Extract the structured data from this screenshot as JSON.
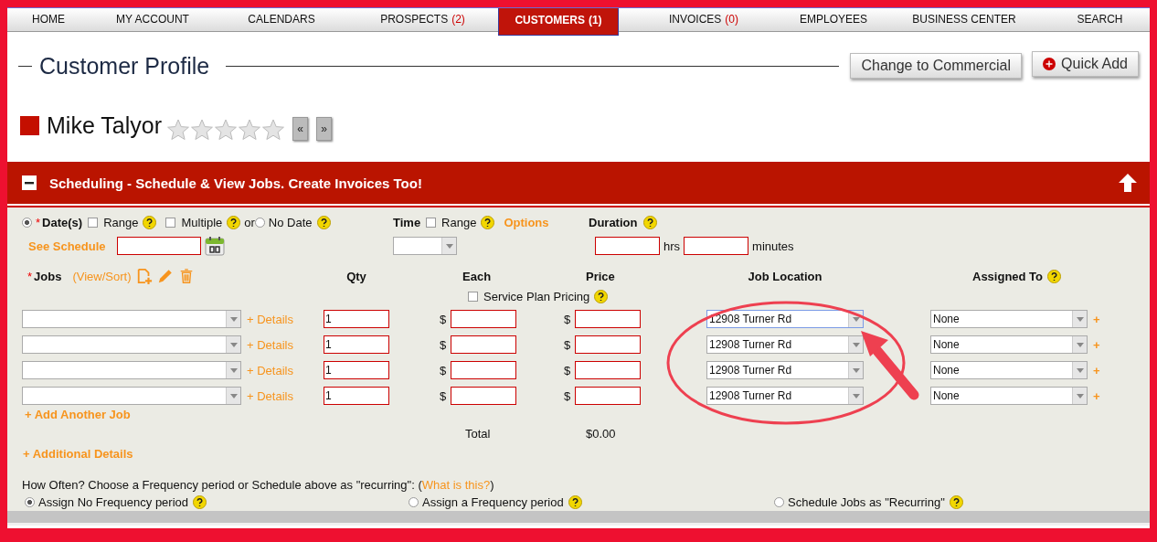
{
  "nav": [
    {
      "label": "HOME",
      "selected": false
    },
    {
      "label": "MY ACCOUNT",
      "selected": false
    },
    {
      "label": "CALENDARS",
      "selected": false
    },
    {
      "label": "PROSPECTS",
      "count": "(2)",
      "selected": false
    },
    {
      "label": "CUSTOMERS",
      "count": "(1)",
      "selected": true
    },
    {
      "label": "INVOICES",
      "count": "(0)",
      "selected": false
    },
    {
      "label": "EMPLOYEES",
      "selected": false
    },
    {
      "label": "BUSINESS CENTER",
      "selected": false
    },
    {
      "label": "SEARCH",
      "selected": false
    }
  ],
  "page_title": "Customer Profile",
  "header_buttons": [
    {
      "label": "Change to Commercial",
      "kind": "plain"
    },
    {
      "label": "Quick Add",
      "kind": "add"
    }
  ],
  "customer": {
    "name": "Mike Talyor",
    "stars": 0,
    "prev": "«",
    "next": "»"
  },
  "section": {
    "title": "Scheduling - Schedule & View Jobs. Create Invoices Too!"
  },
  "date_choices": [
    {
      "kind": "radio",
      "label": "Date(s)",
      "selected": true,
      "required_mark": "*"
    },
    {
      "kind": "checkbox",
      "label": "Range",
      "checked": false,
      "help": true
    },
    {
      "kind": "checkbox",
      "label": "Multiple",
      "checked": false,
      "help": true
    },
    {
      "kind": "text",
      "label": "or",
      "help": false
    },
    {
      "kind": "radio",
      "label": "No Date",
      "selected": false,
      "help": true
    }
  ],
  "see_schedule": "See Schedule",
  "time": {
    "label": "Time",
    "range": {
      "label": "Range",
      "checked": false
    },
    "options_link": "Options"
  },
  "duration": {
    "label": "Duration",
    "hours_unit": "hrs",
    "minutes_unit": "minutes"
  },
  "jobs": {
    "required_mark": "*",
    "label": "Jobs",
    "view_sort": "(View/Sort)",
    "columns": {
      "qty": "Qty",
      "each": "Each",
      "price": "Price",
      "location": "Job Location",
      "assigned": "Assigned To"
    },
    "service_plan": {
      "label": "Service Plan Pricing",
      "checked": false
    },
    "rows": [
      {
        "details_link": "+ Details",
        "qty": "1",
        "each_currency": "$",
        "price_currency": "$",
        "location": "12908 Turner Rd",
        "focused": true,
        "assigned": "None",
        "add_mark": "+"
      },
      {
        "details_link": "+ Details",
        "qty": "1",
        "each_currency": "$",
        "price_currency": "$",
        "location": "12908 Turner Rd",
        "focused": false,
        "assigned": "None",
        "add_mark": "+"
      },
      {
        "details_link": "+ Details",
        "qty": "1",
        "each_currency": "$",
        "price_currency": "$",
        "location": "12908 Turner Rd",
        "focused": false,
        "assigned": "None",
        "add_mark": "+"
      },
      {
        "details_link": "+ Details",
        "qty": "1",
        "each_currency": "$",
        "price_currency": "$",
        "location": "12908 Turner Rd",
        "focused": false,
        "assigned": "None",
        "add_mark": "+"
      }
    ],
    "add_link": "+ Add Another Job",
    "total_label": "Total",
    "total": "$0.00",
    "additional_link": "+ Additional Details"
  },
  "frequency": {
    "question": "How Often? Choose a Frequency period or Schedule above as \"recurring\": (",
    "help_link": "What is this?",
    "close": ")",
    "options": [
      {
        "label": "Assign No Frequency period",
        "selected": true
      },
      {
        "label": "Assign a Frequency period",
        "selected": false
      },
      {
        "label": "Schedule Jobs as \"Recurring\"",
        "selected": false
      }
    ]
  }
}
